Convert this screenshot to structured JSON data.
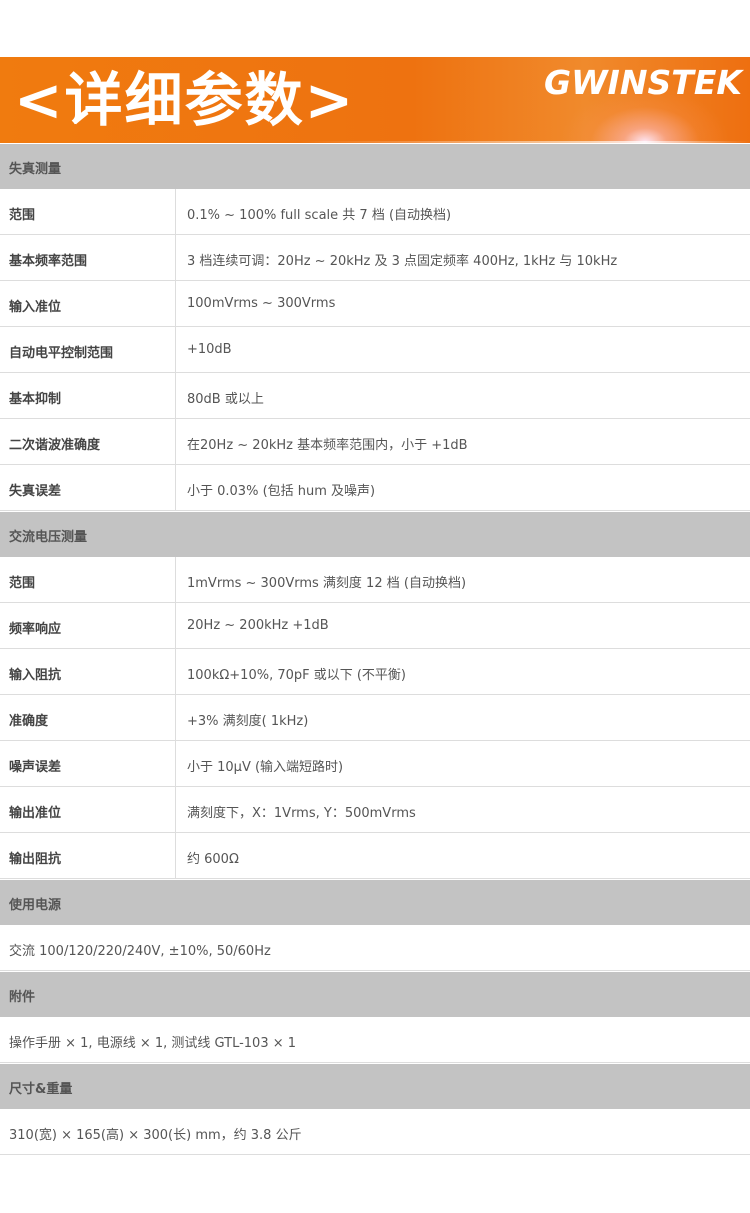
{
  "banner": {
    "title": "<详细参数>",
    "brand": "GWINSTEK",
    "brand_color": "#ffffff",
    "background_color": "#f07b0f"
  },
  "sections": [
    {
      "title": "失真测量",
      "rows": [
        {
          "key": "范围",
          "value": "0.1% ~ 100% full scale 共 7 档 (自动换档)"
        },
        {
          "key": "基本频率范围",
          "value": "3 档连续可调：20Hz ~ 20kHz 及 3 点固定频率 400Hz, 1kHz 与 10kHz"
        },
        {
          "key": "输入准位",
          "value": "100mVrms ~ 300Vrms"
        },
        {
          "key": "自动电平控制范围",
          "value": "+10dB"
        },
        {
          "key": "基本抑制",
          "value": "80dB 或以上"
        },
        {
          "key": "二次谐波准确度",
          "value": "在20Hz ~ 20kHz 基本频率范围内，小于 +1dB"
        },
        {
          "key": "失真误差",
          "value": "小于 0.03% (包括 hum 及噪声)"
        }
      ]
    },
    {
      "title": "交流电压测量",
      "rows": [
        {
          "key": "范围",
          "value": "1mVrms ~ 300Vrms 满刻度  12 档 (自动换档)"
        },
        {
          "key": "频率响应",
          "value": "20Hz ~ 200kHz +1dB"
        },
        {
          "key": "输入阻抗",
          "value": "100kΩ+10%, 70pF 或以下 (不平衡)"
        },
        {
          "key": "准确度",
          "value": "+3% 满刻度( 1kHz)"
        },
        {
          "key": "噪声误差",
          "value": "小于 10μV (输入端短路时)"
        },
        {
          "key": "输出准位",
          "value": "满刻度下，X：1Vrms, Y：500mVrms"
        },
        {
          "key": "输出阻抗",
          "value": "约 600Ω"
        }
      ]
    },
    {
      "title": "使用电源",
      "text": "交流 100/120/220/240V, ±10%, 50/60Hz"
    },
    {
      "title": "附件",
      "text": "操作手册 × 1, 电源线 × 1, 测试线 GTL-103 × 1"
    },
    {
      "title": "尺寸&重量",
      "text": "310(宽) × 165(高) × 300(长) mm，约 3.8 公斤"
    }
  ]
}
